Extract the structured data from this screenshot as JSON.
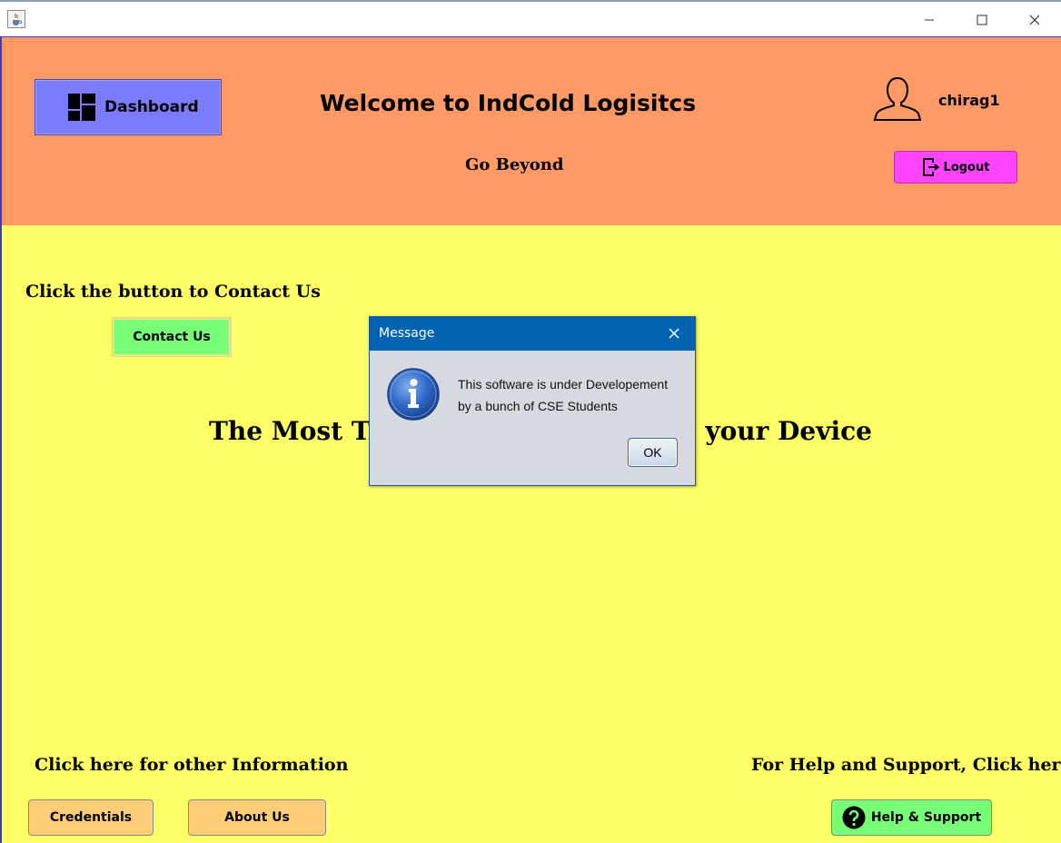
{
  "window": {
    "icon": "java-cup-icon",
    "controls": [
      "minimize-icon",
      "maximize-icon",
      "close-icon"
    ]
  },
  "header": {
    "dashboard_label": "Dashboard",
    "title": "Welcome to IndCold Logisitcs",
    "tagline": "Go Beyond",
    "username": "chirag1",
    "logout_label": "Logout",
    "background": "#ff9966"
  },
  "main": {
    "background": "#ffff66",
    "contact_prompt": "Click the button to Contact Us",
    "contact_label": "Contact Us",
    "headline_left": "The Most Tru",
    "headline_right": "in your Device",
    "info_prompt": "Click here for other Information",
    "help_prompt": "For Help and Support, Click here",
    "credentials_label": "Credentials",
    "about_label": "About Us",
    "help_label": "Help & Support"
  },
  "dialog": {
    "title": "Message",
    "line1": "This software is under Developement",
    "line2": "by a bunch of CSE Students",
    "ok_label": "OK",
    "titlebar_color": "#0063b1"
  }
}
